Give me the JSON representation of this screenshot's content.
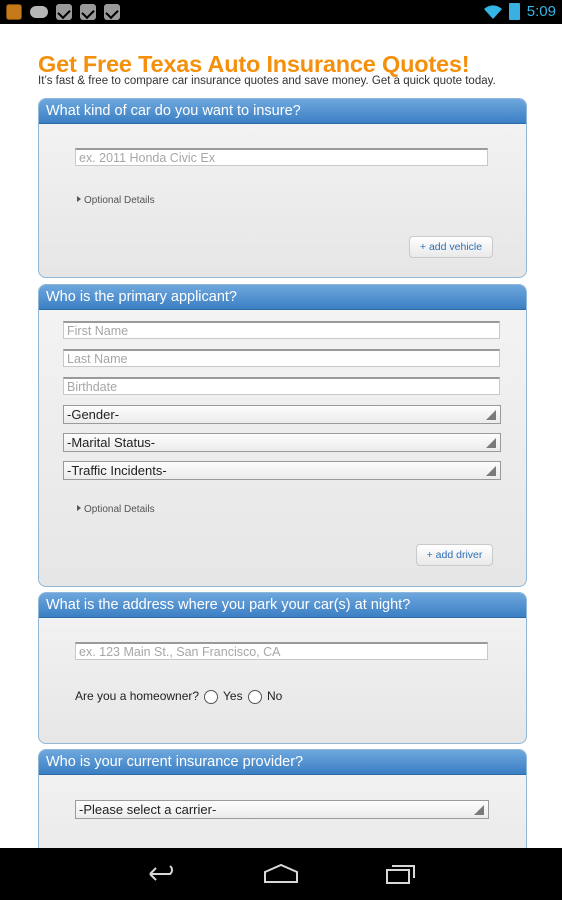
{
  "status_bar": {
    "time": "5:09",
    "left_icons": [
      "app-icon",
      "cat-icon",
      "clipboard-check-icon",
      "bag-check-icon",
      "clipboard-check-icon"
    ],
    "right_icons": [
      "wifi-icon",
      "battery-icon"
    ],
    "accent": "#33b5e5"
  },
  "page": {
    "title": "Get Free Texas Auto Insurance Quotes!",
    "subtitle": "It’s fast & free to compare car insurance quotes and save money. Get a quick quote today.",
    "title_color": "#f4900c"
  },
  "vehicle_section": {
    "header": "What kind of car do you want to insure?",
    "car_placeholder": "ex. 2011 Honda Civic Ex",
    "optional_details": "Optional Details",
    "add_button": "+ add vehicle"
  },
  "applicant_section": {
    "header": "Who is the primary applicant?",
    "first_name_placeholder": "First Name",
    "last_name_placeholder": "Last Name",
    "birthdate_placeholder": "Birthdate",
    "gender_select": "-Gender-",
    "marital_select": "-Marital Status-",
    "incidents_select": "-Traffic Incidents-",
    "optional_details": "Optional Details",
    "add_button": "+ add driver"
  },
  "address_section": {
    "header": "What is the address where you park your car(s) at night?",
    "address_placeholder": "ex. 123 Main St., San Francisco, CA",
    "homeowner_question": "Are you a homeowner?",
    "yes_label": "Yes",
    "no_label": "No"
  },
  "provider_section": {
    "header": "Who is your current insurance provider?",
    "carrier_select": "-Please select a carrier-"
  },
  "nav_bar": {
    "icons": [
      "back-icon",
      "home-icon",
      "recent-apps-icon"
    ]
  }
}
